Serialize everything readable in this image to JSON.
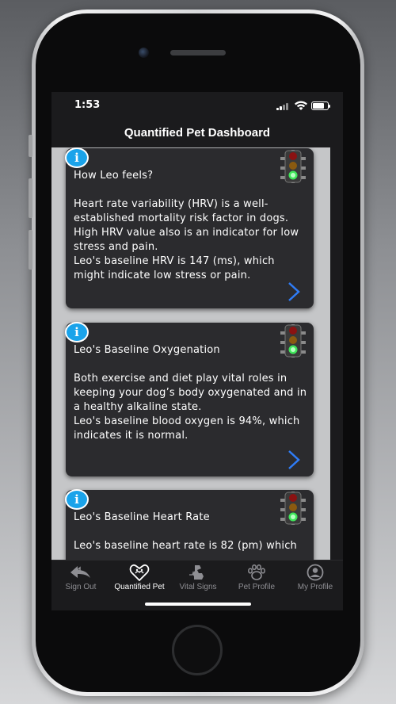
{
  "status_bar": {
    "time": "1:53"
  },
  "nav": {
    "title": "Quantified Pet Dashboard"
  },
  "cards": [
    {
      "title": "How Leo feels?",
      "body": "Heart rate variability (HRV) is a well-established mortality risk factor in dogs. High HRV value also is an indicator for low stress and pain.\nLeo's baseline HRV is 147 (ms), which might indicate low stress or pain.",
      "info_icon": "info-icon",
      "status_light": "green"
    },
    {
      "title": "Leo's Baseline Oxygenation",
      "body": "Both exercise and diet play vital roles in keeping your dog’s body oxygenated and in a healthy alkaline state.\nLeo's baseline blood oxygen is 94%, which indicates it is normal.",
      "info_icon": "info-icon",
      "status_light": "green"
    },
    {
      "title": "Leo's Baseline Heart Rate",
      "body": "Leo's baseline heart rate is 82 (pm) which",
      "info_icon": "info-icon",
      "status_light": "green"
    }
  ],
  "tabs": [
    {
      "label": "Sign Out",
      "icon": "sign-out-icon",
      "active": false
    },
    {
      "label": "Quantified Pet",
      "icon": "pet-heart-icon",
      "active": true
    },
    {
      "label": "Vital Signs",
      "icon": "dog-vitals-icon",
      "active": false
    },
    {
      "label": "Pet Profile",
      "icon": "paw-icon",
      "active": false
    },
    {
      "label": "My Profile",
      "icon": "user-profile-icon",
      "active": false
    }
  ],
  "colors": {
    "accent_blue": "#1aa3ea",
    "chevron_blue": "#2f7cf6",
    "card_bg": "#2b2b2e",
    "light_green": "#3fe65a"
  }
}
